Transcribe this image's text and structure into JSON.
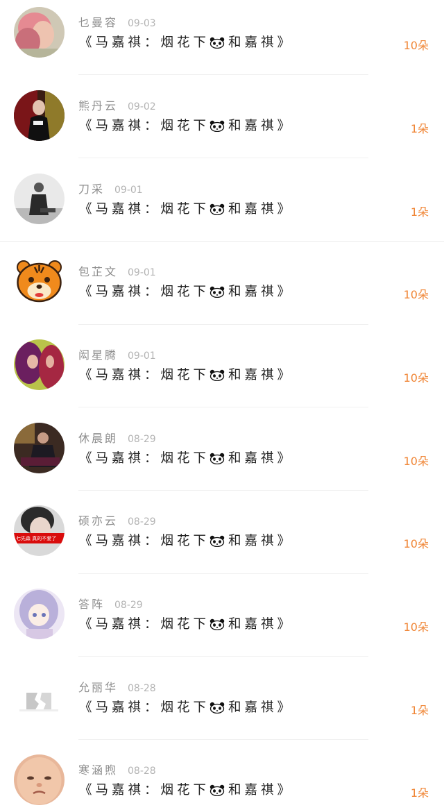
{
  "gift_title_prefix": "《马嘉祺：烟花下",
  "gift_title_suffix": "和嘉祺》",
  "items": [
    {
      "name": "乜曼容",
      "date": "09-03",
      "count": "10朵",
      "avatar": "pink-hair-woman-avatar"
    },
    {
      "name": "熊丹云",
      "date": "09-02",
      "count": "1朵",
      "avatar": "woman-red-background-avatar"
    },
    {
      "name": "刀采",
      "date": "09-01",
      "count": "1朵",
      "avatar": "man-black-white-avatar"
    },
    {
      "name": "包芷文",
      "date": "09-01",
      "count": "10朵",
      "avatar": "cartoon-tiger-avatar"
    },
    {
      "name": "闳星腾",
      "date": "09-01",
      "count": "10朵",
      "avatar": "purple-red-hair-avatar"
    },
    {
      "name": "休晨朗",
      "date": "08-29",
      "count": "10朵",
      "avatar": "man-dark-room-avatar"
    },
    {
      "name": "硕亦云",
      "date": "08-29",
      "count": "10朵",
      "avatar": "girl-red-band-avatar",
      "avatar_text": "七先森 真的不爱了"
    },
    {
      "name": "答阵",
      "date": "08-29",
      "count": "10朵",
      "avatar": "anime-girl-avatar"
    },
    {
      "name": "允丽华",
      "date": "08-28",
      "count": "1朵",
      "avatar": "broken-white-heart-avatar"
    },
    {
      "name": "寒涵煦",
      "date": "08-28",
      "count": "1朵",
      "avatar": "baby-face-avatar"
    }
  ],
  "colors": {
    "count": "#f0883a",
    "name": "#8d8d8d",
    "date": "#b3b3b3",
    "title": "#222222"
  }
}
